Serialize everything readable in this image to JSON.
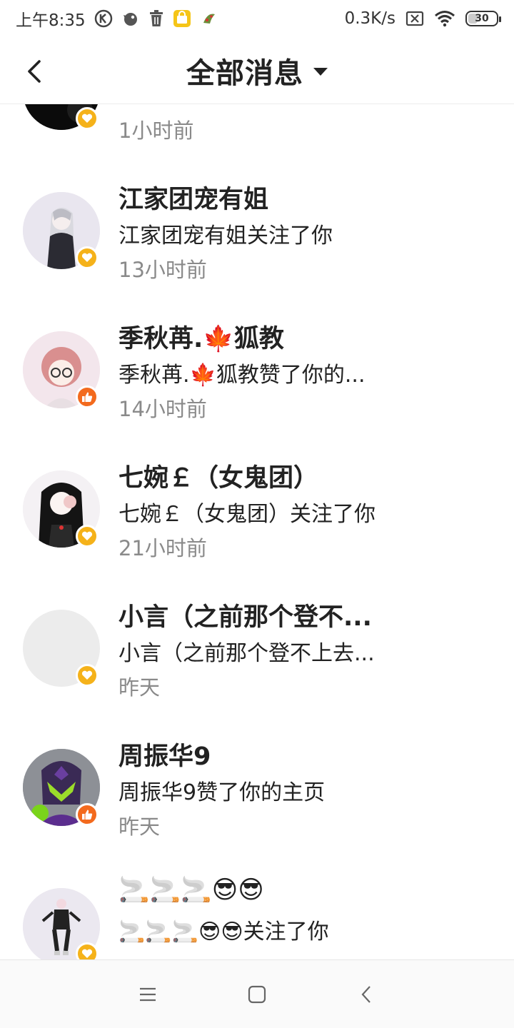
{
  "status_bar": {
    "time": "上午8:35",
    "net_speed": "0.3K/s",
    "battery": "30"
  },
  "header": {
    "title": "全部消息"
  },
  "messages": [
    {
      "name": "",
      "desc": "",
      "time": "1小时前",
      "badge": "follow"
    },
    {
      "name": "江家团宠有姐",
      "desc": "江家团宠有姐关注了你",
      "time": "13小时前",
      "badge": "follow"
    },
    {
      "name": "季秋苒.🍁狐教",
      "desc": "季秋苒.🍁狐教赞了你的...",
      "time": "14小时前",
      "badge": "like"
    },
    {
      "name": "七婉￡（女鬼团）",
      "desc": "七婉￡（女鬼团）关注了你",
      "time": "21小时前",
      "badge": "follow"
    },
    {
      "name": "小言（之前那个登不...",
      "desc": "小言（之前那个登不上去...",
      "time": "昨天",
      "badge": "follow"
    },
    {
      "name": "周振华9",
      "desc": "周振华9赞了你的主页",
      "time": "昨天",
      "badge": "like"
    },
    {
      "name": "🚬🚬🚬😎😎",
      "desc": "🚬🚬🚬😎😎关注了你",
      "time": "",
      "badge": "follow"
    }
  ],
  "icons": {
    "follow_badge": "heart-icon",
    "like_badge": "thumbs-up-icon",
    "back": "chevron-left-icon",
    "dropdown": "caret-down-icon"
  },
  "colors": {
    "follow_badge": "#f5b21a",
    "like_badge": "#f36a1d",
    "time_text": "#8a8a8a"
  }
}
